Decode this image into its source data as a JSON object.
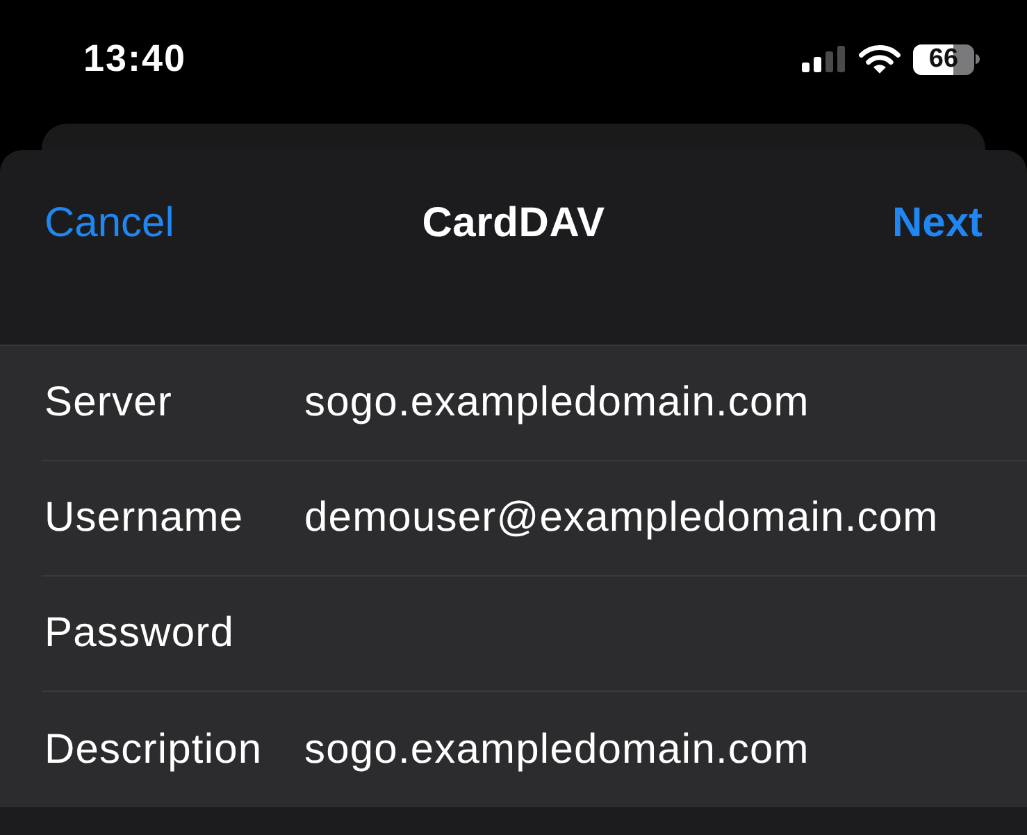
{
  "status_bar": {
    "time": "13:40",
    "battery": "66"
  },
  "nav_bar": {
    "cancel": "Cancel",
    "title": "CardDAV",
    "next": "Next"
  },
  "fields": [
    {
      "label": "Server",
      "value": "sogo.exampledomain.com"
    },
    {
      "label": "Username",
      "value": "demouser@exampledomain.com"
    },
    {
      "label": "Password"
    },
    {
      "label": "Description",
      "value": "sogo.exampledomain.com"
    }
  ]
}
